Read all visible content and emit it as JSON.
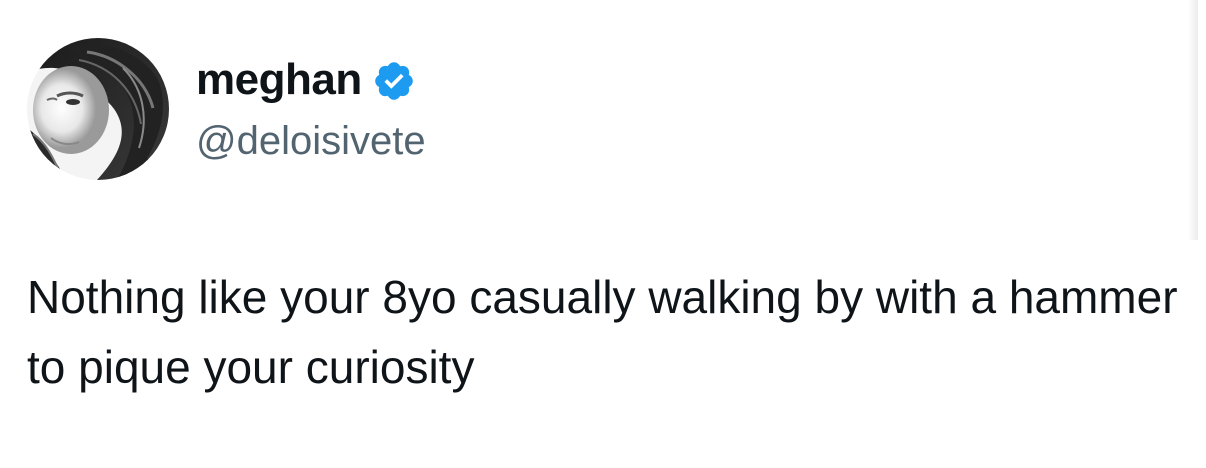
{
  "author": {
    "display_name": "meghan",
    "handle": "@deloisivete",
    "verified": true,
    "verified_badge_icon": "verified-badge-icon",
    "verified_badge_color": "#1d9bf0",
    "avatar_icon": "profile-photo"
  },
  "tweet": {
    "text": "Nothing like your 8yo casually walking by with a hammer  to pique your curiosity"
  },
  "colors": {
    "name_text": "#0f1419",
    "handle_text": "#536471",
    "background": "#ffffff"
  }
}
